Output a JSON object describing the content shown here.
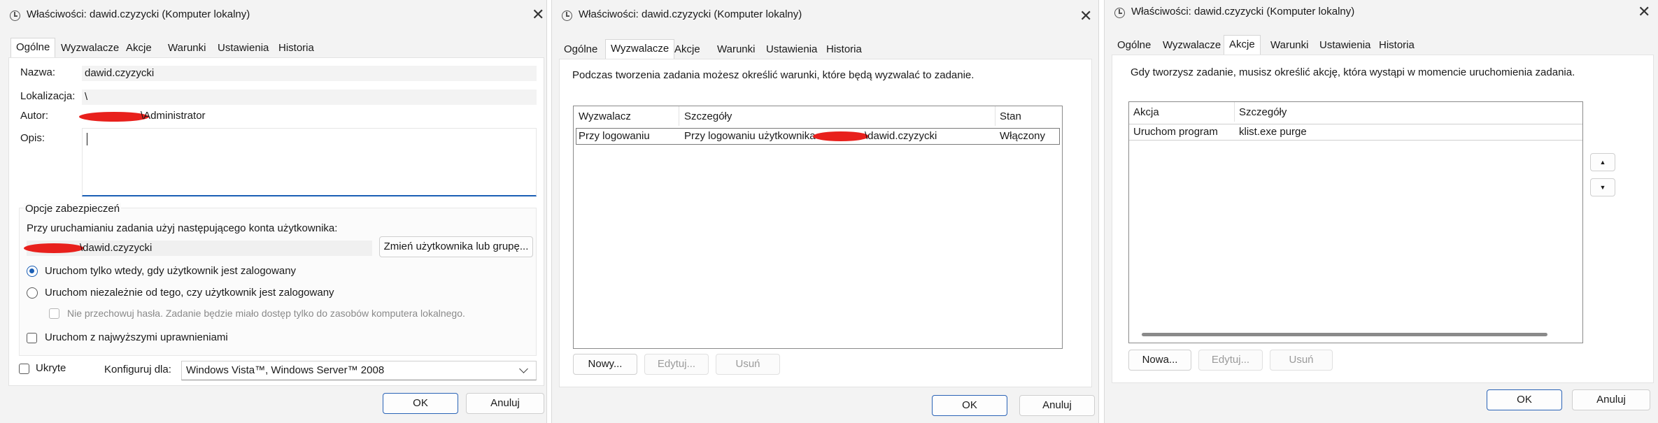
{
  "dialogs": {
    "general": {
      "title": "Właściwości: dawid.czyzycki (Komputer lokalny)",
      "close": "✕",
      "tabs": [
        "Ogólne",
        "Wyzwalacze",
        "Akcje",
        "Warunki",
        "Ustawienia",
        "Historia"
      ],
      "name_label": "Nazwa:",
      "name_value": "dawid.czyzycki",
      "location_label": "Lokalizacja:",
      "location_value": "\\",
      "author_label": "Autor:",
      "author_value": "\\Administrator",
      "description_label": "Opis:",
      "security_group": "Opcje zabezpieczeń",
      "account_prompt": "Przy uruchamianiu zadania użyj następującego konta użytkownika:",
      "account_value": "\\dawid.czyzycki",
      "change_user_button": "Zmień użytkownika lub grupę...",
      "radio_logged_on": "Uruchom tylko wtedy, gdy użytkownik jest zalogowany",
      "radio_any": "Uruchom niezależnie od tego, czy użytkownik jest zalogowany",
      "no_store_password": "Nie przechowuj hasła. Zadanie będzie miało dostęp tylko do zasobów komputera lokalnego.",
      "highest_privileges": "Uruchom z najwyższymi uprawnieniami",
      "hidden": "Ukryte",
      "configure_label": "Konfiguruj dla:",
      "configure_value": "Windows Vista™, Windows Server™ 2008",
      "ok": "OK",
      "cancel": "Anuluj"
    },
    "triggers": {
      "title": "Właściwości: dawid.czyzycki (Komputer lokalny)",
      "close": "✕",
      "tabs": [
        "Ogólne",
        "Wyzwalacze",
        "Akcje",
        "Warunki",
        "Ustawienia",
        "Historia"
      ],
      "info": "Podczas tworzenia zadania możesz określić warunki, które będą wyzwalać to zadanie.",
      "columns": [
        "Wyzwalacz",
        "Szczegóły",
        "Stan"
      ],
      "row": {
        "trigger": "Przy logowaniu",
        "details_prefix": "Przy logowaniu użytkownika",
        "details_suffix": "\\dawid.czyzycki",
        "state": "Włączony"
      },
      "new": "Nowy...",
      "edit": "Edytuj...",
      "delete": "Usuń",
      "ok": "OK",
      "cancel": "Anuluj"
    },
    "actions": {
      "title": "Właściwości: dawid.czyzycki (Komputer lokalny)",
      "close": "✕",
      "tabs": [
        "Ogólne",
        "Wyzwalacze",
        "Akcje",
        "Warunki",
        "Ustawienia",
        "Historia"
      ],
      "info": "Gdy tworzysz zadanie, musisz określić akcję, która wystąpi w momencie uruchomienia zadania.",
      "columns": [
        "Akcja",
        "Szczegóły"
      ],
      "row": {
        "action": "Uruchom program",
        "details": "klist.exe purge"
      },
      "up": "▲",
      "down": "▼",
      "new": "Nowa...",
      "edit": "Edytuj...",
      "delete": "Usuń",
      "ok": "OK",
      "cancel": "Anuluj"
    }
  },
  "colors": {
    "accent": "#1b5fb5",
    "redaction": "#e8201c",
    "dialog_bg": "#f3f3f3"
  }
}
